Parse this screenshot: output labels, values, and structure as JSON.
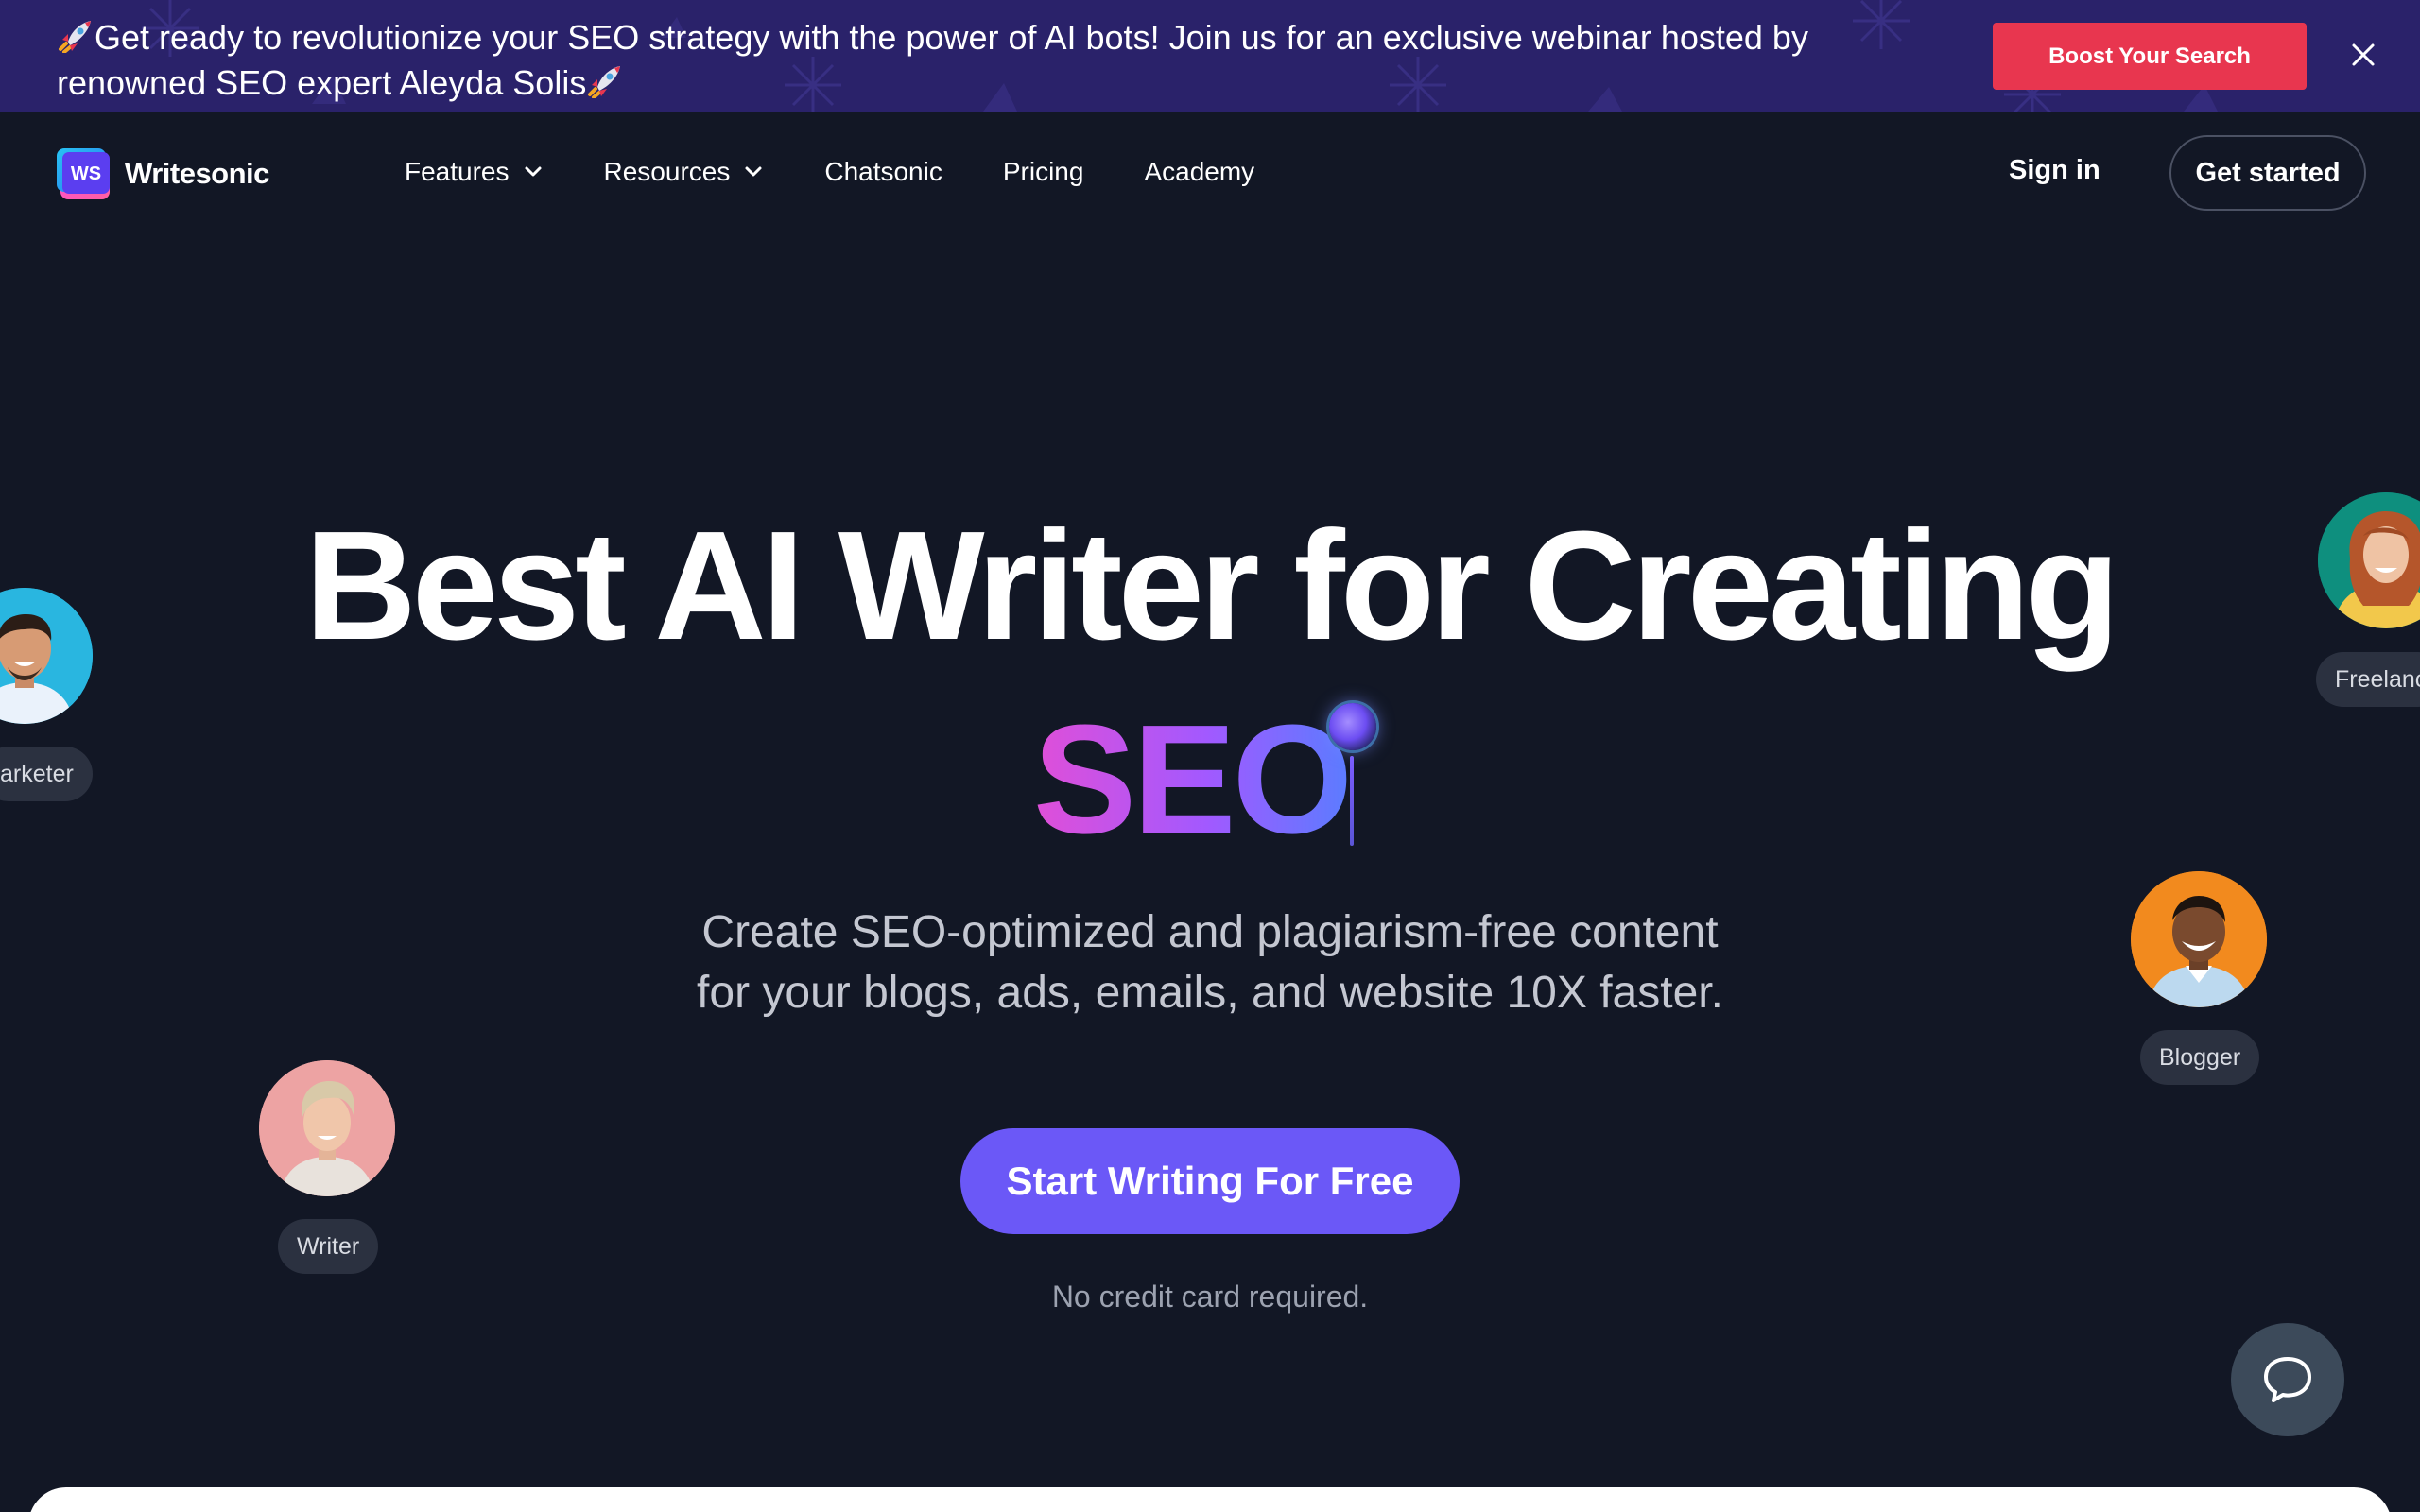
{
  "banner": {
    "text": "Get ready to revolutionize your SEO strategy with the power of AI bots! Join us for an exclusive webinar hosted by renowned SEO expert Aleyda Solis",
    "cta_label": "Boost Your Search",
    "close_icon": "close-icon"
  },
  "nav": {
    "logo_mark": "WS",
    "logo_name": "Writesonic",
    "items": [
      {
        "label": "Features",
        "has_dropdown": true
      },
      {
        "label": "Resources",
        "has_dropdown": true
      },
      {
        "label": "Chatsonic",
        "has_dropdown": false
      },
      {
        "label": "Pricing",
        "has_dropdown": false
      },
      {
        "label": "Academy",
        "has_dropdown": false
      }
    ],
    "sign_in": "Sign in",
    "get_started": "Get started"
  },
  "hero": {
    "title": "Best AI Writer for Creating",
    "highlight": "SEO",
    "subtitle_line1": "Create SEO-optimized and plagiarism-free content",
    "subtitle_line2": "for your blogs, ads, emails, and website 10X faster.",
    "cta_label": "Start Writing For Free",
    "note": "No credit card required."
  },
  "personas": [
    {
      "label": "arketer",
      "bg": "#29b6e0"
    },
    {
      "label": "Freelanc",
      "bg": "#0e8f7e"
    },
    {
      "label": "Blogger",
      "bg": "#f28a1e"
    },
    {
      "label": "Writer",
      "bg": "#eda3a3"
    }
  ],
  "colors": {
    "background": "#121725",
    "banner": "#2a226a",
    "banner_cta": "#e8364f",
    "primary_cta": "#6b58f7",
    "chat_button": "#3c4a5a"
  },
  "icons": {
    "chat": "chat-bubble-icon",
    "rocket": "rocket-icon",
    "chevron": "chevron-down-icon"
  }
}
